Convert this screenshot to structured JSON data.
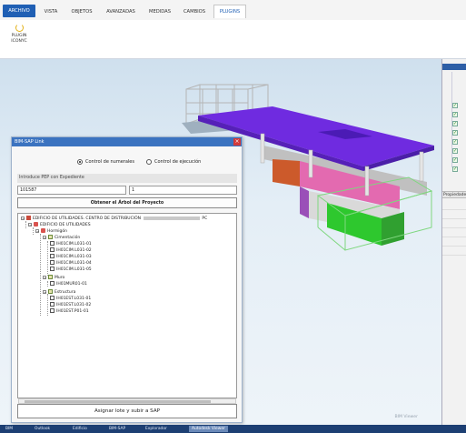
{
  "ribbon": {
    "tabs": [
      {
        "label": "ARCHIVO"
      },
      {
        "label": "VISTA"
      },
      {
        "label": "OBJETOS"
      },
      {
        "label": "AVANZADAS"
      },
      {
        "label": "MEDIDAS"
      },
      {
        "label": "CAMBIOS"
      },
      {
        "label": "PLUGINS"
      }
    ],
    "plugin_button": {
      "line1": "PLUGIN",
      "line2": "ICONYC"
    }
  },
  "viewport": {
    "caption": "BIM Viewer"
  },
  "right_panel": {
    "header": "Propiedades"
  },
  "dialog": {
    "title": "BIM-SAP Link",
    "close": "×",
    "radio_1": "Control de numerales",
    "radio_2": "Control de ejecución",
    "pep_label": "Introduce PEP con Expediente",
    "pep_value": "101587",
    "expediente_value": "1",
    "get_tree_button": "Obtener el Árbol del Proyecto",
    "assign_button": "Asignar lote y subir a SAP",
    "tree": [
      {
        "label": "EDIFICIO DE UTILIDADES. CENTRO DE DISTRIBUCIÓN",
        "suffix": "PC"
      },
      {
        "label": "EDIFICIO DE UTILIDADES"
      },
      {
        "label": "Hormigón"
      },
      {
        "label": "Cimentación"
      },
      {
        "label": "IH01CIM.L031-01"
      },
      {
        "label": "IH01CIM.L031-02"
      },
      {
        "label": "IH01CIM.L031-03"
      },
      {
        "label": "IH01CIM.L031-04"
      },
      {
        "label": "IH01CIM.L031-05"
      },
      {
        "label": "Muro"
      },
      {
        "label": "IH01MUR01-01"
      },
      {
        "label": "Estructura"
      },
      {
        "label": "IH01EST.L031-01"
      },
      {
        "label": "IH01EST.L031-02"
      },
      {
        "label": "IH01EST.P01-01"
      }
    ]
  },
  "taskbar": {
    "items": [
      "BIM",
      "Outlook",
      "Edificio",
      "BIM-SAP",
      "Explorador"
    ],
    "active_window": "Autodesk Viewer"
  }
}
